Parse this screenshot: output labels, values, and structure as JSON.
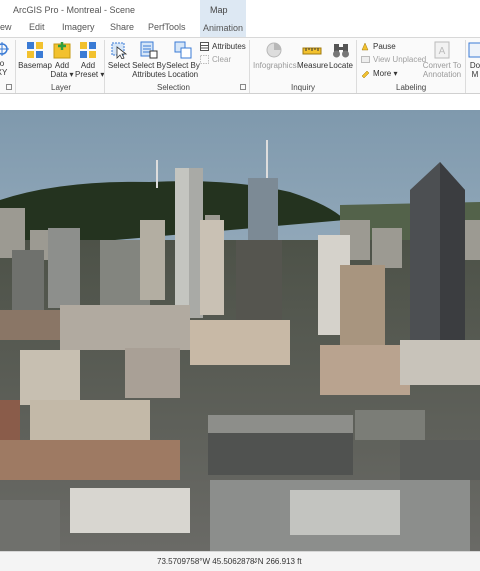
{
  "window": {
    "title": "ArcGIS Pro - Montreal - Scene",
    "context_tab_group": "Map"
  },
  "tabs": [
    {
      "label": "iew"
    },
    {
      "label": "Edit"
    },
    {
      "label": "Imagery"
    },
    {
      "label": "Share"
    },
    {
      "label": "PerfTools"
    },
    {
      "label": "Animation"
    }
  ],
  "ribbon": {
    "groups": {
      "layer": "Layer",
      "selection": "Selection",
      "inquiry": "Inquiry",
      "labeling": "Labeling"
    },
    "buttons": {
      "goto_xy_line1": "o",
      "goto_xy_line2": "XY",
      "basemap": "Basemap",
      "add_data_line1": "Add",
      "add_data_line2": "Data ▾",
      "add_preset_line1": "Add",
      "add_preset_line2": "Preset ▾",
      "select": "Select",
      "select_by_attr_line1": "Select By",
      "select_by_attr_line2": "Attributes",
      "select_by_loc_line1": "Select By",
      "select_by_loc_line2": "Location",
      "attributes": "Attributes",
      "clear": "Clear",
      "infographics": "Infographics",
      "measure": "Measure",
      "locate": "Locate",
      "pause": "Pause",
      "view_unplaced": "View Unplaced",
      "more": "More",
      "convert_line1": "Convert To",
      "convert_line2": "Annotation",
      "download_line1": "Do",
      "download_line2": "M"
    },
    "icon_colors": {
      "blue": "#3a7bd5",
      "yellow": "#f2c12e",
      "gray_disabled": "#b8b8b8"
    }
  },
  "status": {
    "coordinates": "73.5709758°W 45.5062878°N",
    "elevation": "266.913 ft"
  }
}
